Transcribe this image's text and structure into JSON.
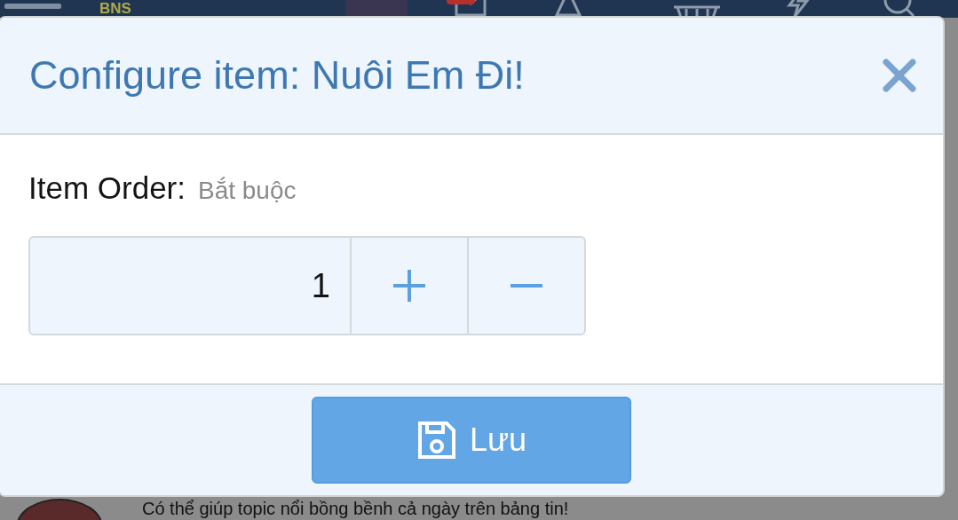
{
  "topbar": {
    "logo": "BNS"
  },
  "background": {
    "message": "Có thể giúp topic nổi bồng bềnh cả ngày trên bảng tin!"
  },
  "dialog": {
    "title": "Configure item: Nuôi Em Đi!",
    "field": {
      "label": "Item Order:",
      "hint": "Bắt buộc",
      "value": "1"
    },
    "save_button": {
      "label": "Lưu"
    }
  }
}
